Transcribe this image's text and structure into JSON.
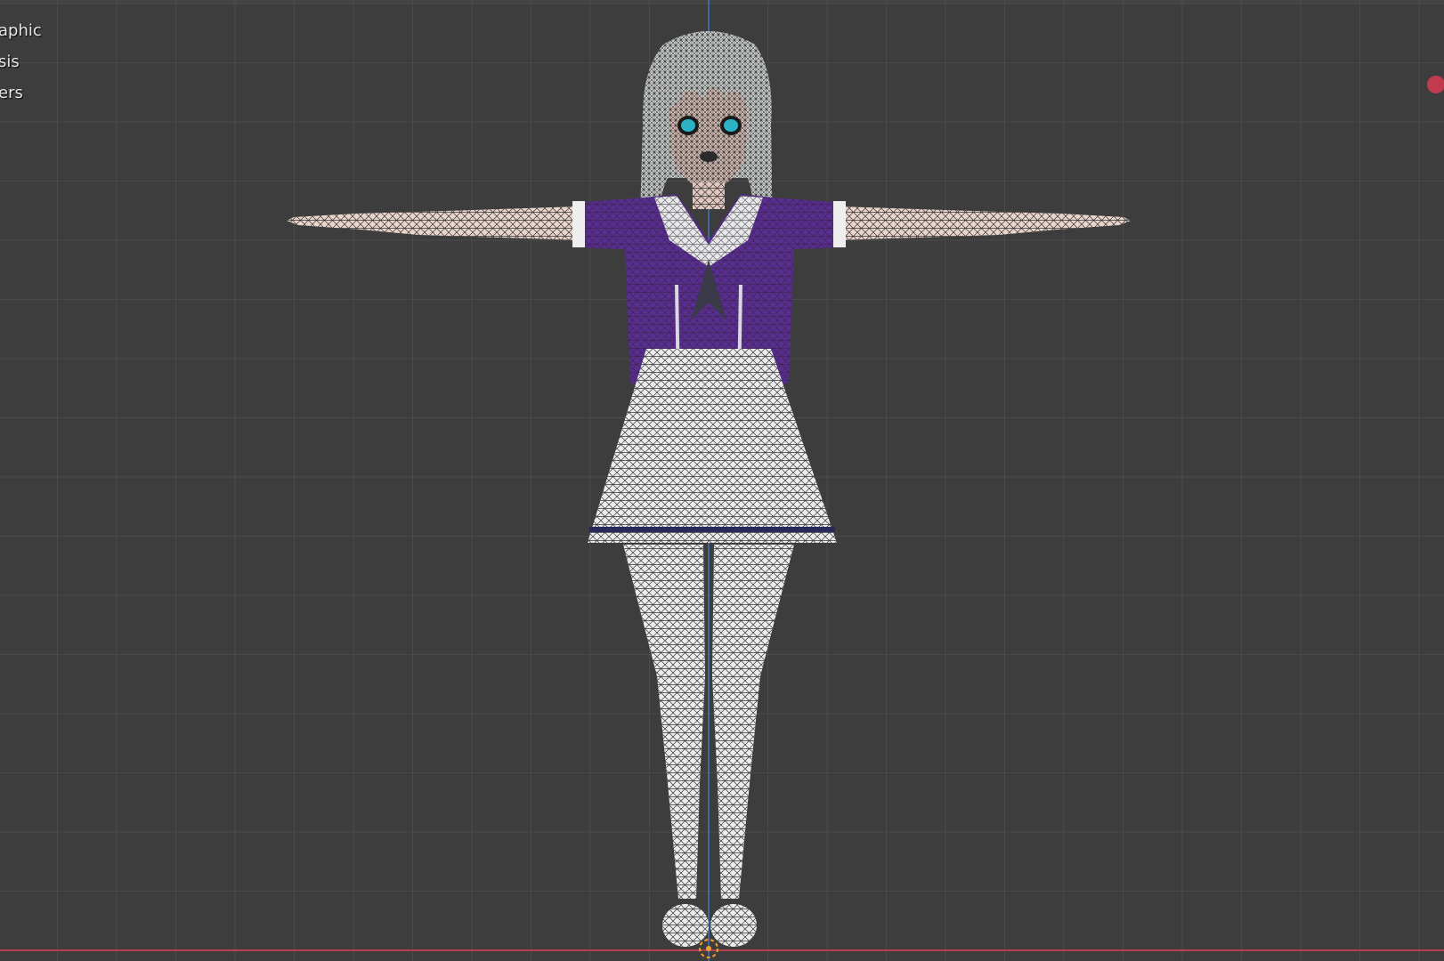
{
  "viewport": {
    "overlay_lines": [
      "aphic",
      "sis",
      "ers"
    ],
    "colors": {
      "background": "#3d3d3d",
      "grid": "#4a4a4a",
      "x_axis": "#b5404f",
      "z_axis": "#3f7ac0",
      "shirt": "#5a2d91",
      "skin": "#e9cfc4",
      "wire": "#1a1a1a",
      "record": "#c13a4e",
      "origin": "#f0a030"
    },
    "icons": {
      "record": "record-dot-icon",
      "origin": "object-origin-icon"
    }
  }
}
